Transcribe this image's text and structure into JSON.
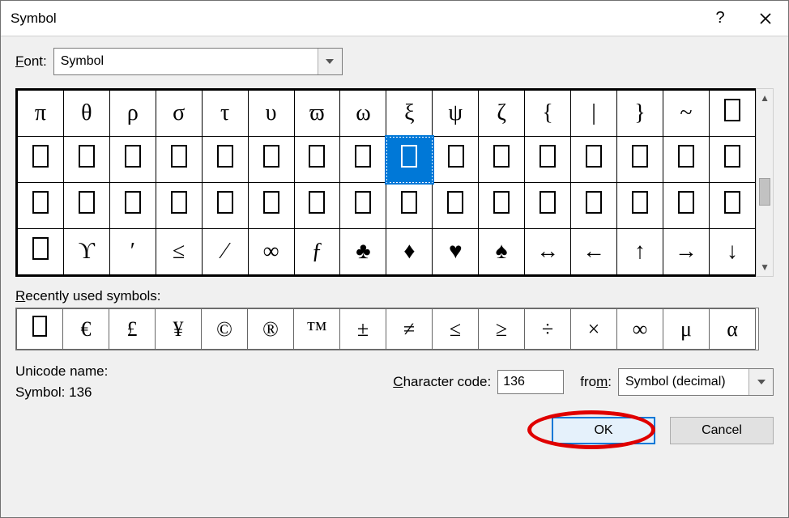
{
  "window": {
    "title": "Symbol"
  },
  "font": {
    "label": "Font:",
    "value": "Symbol"
  },
  "grid": {
    "rows": [
      [
        "π",
        "θ",
        "ρ",
        "σ",
        "τ",
        "υ",
        "ϖ",
        "ω",
        "ξ",
        "ψ",
        "ζ",
        "{",
        "|",
        "}",
        "~",
        "□"
      ],
      [
        "□",
        "□",
        "□",
        "□",
        "□",
        "□",
        "□",
        "□",
        "□",
        "□",
        "□",
        "□",
        "□",
        "□",
        "□",
        "□"
      ],
      [
        "□",
        "□",
        "□",
        "□",
        "□",
        "□",
        "□",
        "□",
        "□",
        "□",
        "□",
        "□",
        "□",
        "□",
        "□",
        "□"
      ],
      [
        "□",
        "ϒ",
        "′",
        "≤",
        "⁄",
        "∞",
        "ƒ",
        "♣",
        "♦",
        "♥",
        "♠",
        "↔",
        "←",
        "↑",
        "→",
        "↓"
      ]
    ],
    "selected_row": 1,
    "selected_col": 8
  },
  "recent": {
    "label": "Recently used symbols:",
    "items": [
      "□",
      "€",
      "£",
      "¥",
      "©",
      "®",
      "™",
      "±",
      "≠",
      "≤",
      "≥",
      "÷",
      "×",
      "∞",
      "μ",
      "α"
    ]
  },
  "unicode": {
    "name_label": "Unicode name:",
    "name_value": "Symbol: 136",
    "code_label": "Character code:",
    "code_value": "136",
    "from_label": "from:",
    "from_value": "Symbol (decimal)"
  },
  "buttons": {
    "ok": "OK",
    "cancel": "Cancel"
  }
}
